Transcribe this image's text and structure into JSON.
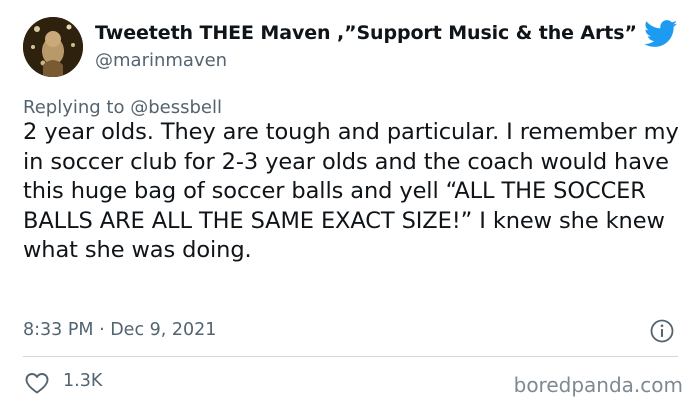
{
  "author": {
    "display_name": "Tweeteth THEE Maven ,”Support Music & the Arts”",
    "handle": "@marinmaven",
    "avatar_icon": "profile-photo"
  },
  "brand": {
    "icon": "twitter-bird-icon",
    "color": "#1d9bf0"
  },
  "reply": {
    "prefix": "Replying to",
    "mention": "@bessbell"
  },
  "tweet": {
    "text": "2 year olds. They are tough and particular. I remember my in soccer club for 2-3 year olds and the coach would have this huge bag of soccer balls and yell “ALL THE SOCCER BALLS ARE ALL THE SAME EXACT SIZE!” I knew she knew what she was doing.",
    "timestamp": "8:33 PM · Dec 9, 2021"
  },
  "actions": {
    "like_icon": "heart-icon",
    "like_count": "1.3K",
    "info_icon": "info-icon"
  },
  "watermark": "boredpanda.com",
  "colors": {
    "text": "#0f1419",
    "secondary": "#536471",
    "divider": "#cfd9de"
  }
}
